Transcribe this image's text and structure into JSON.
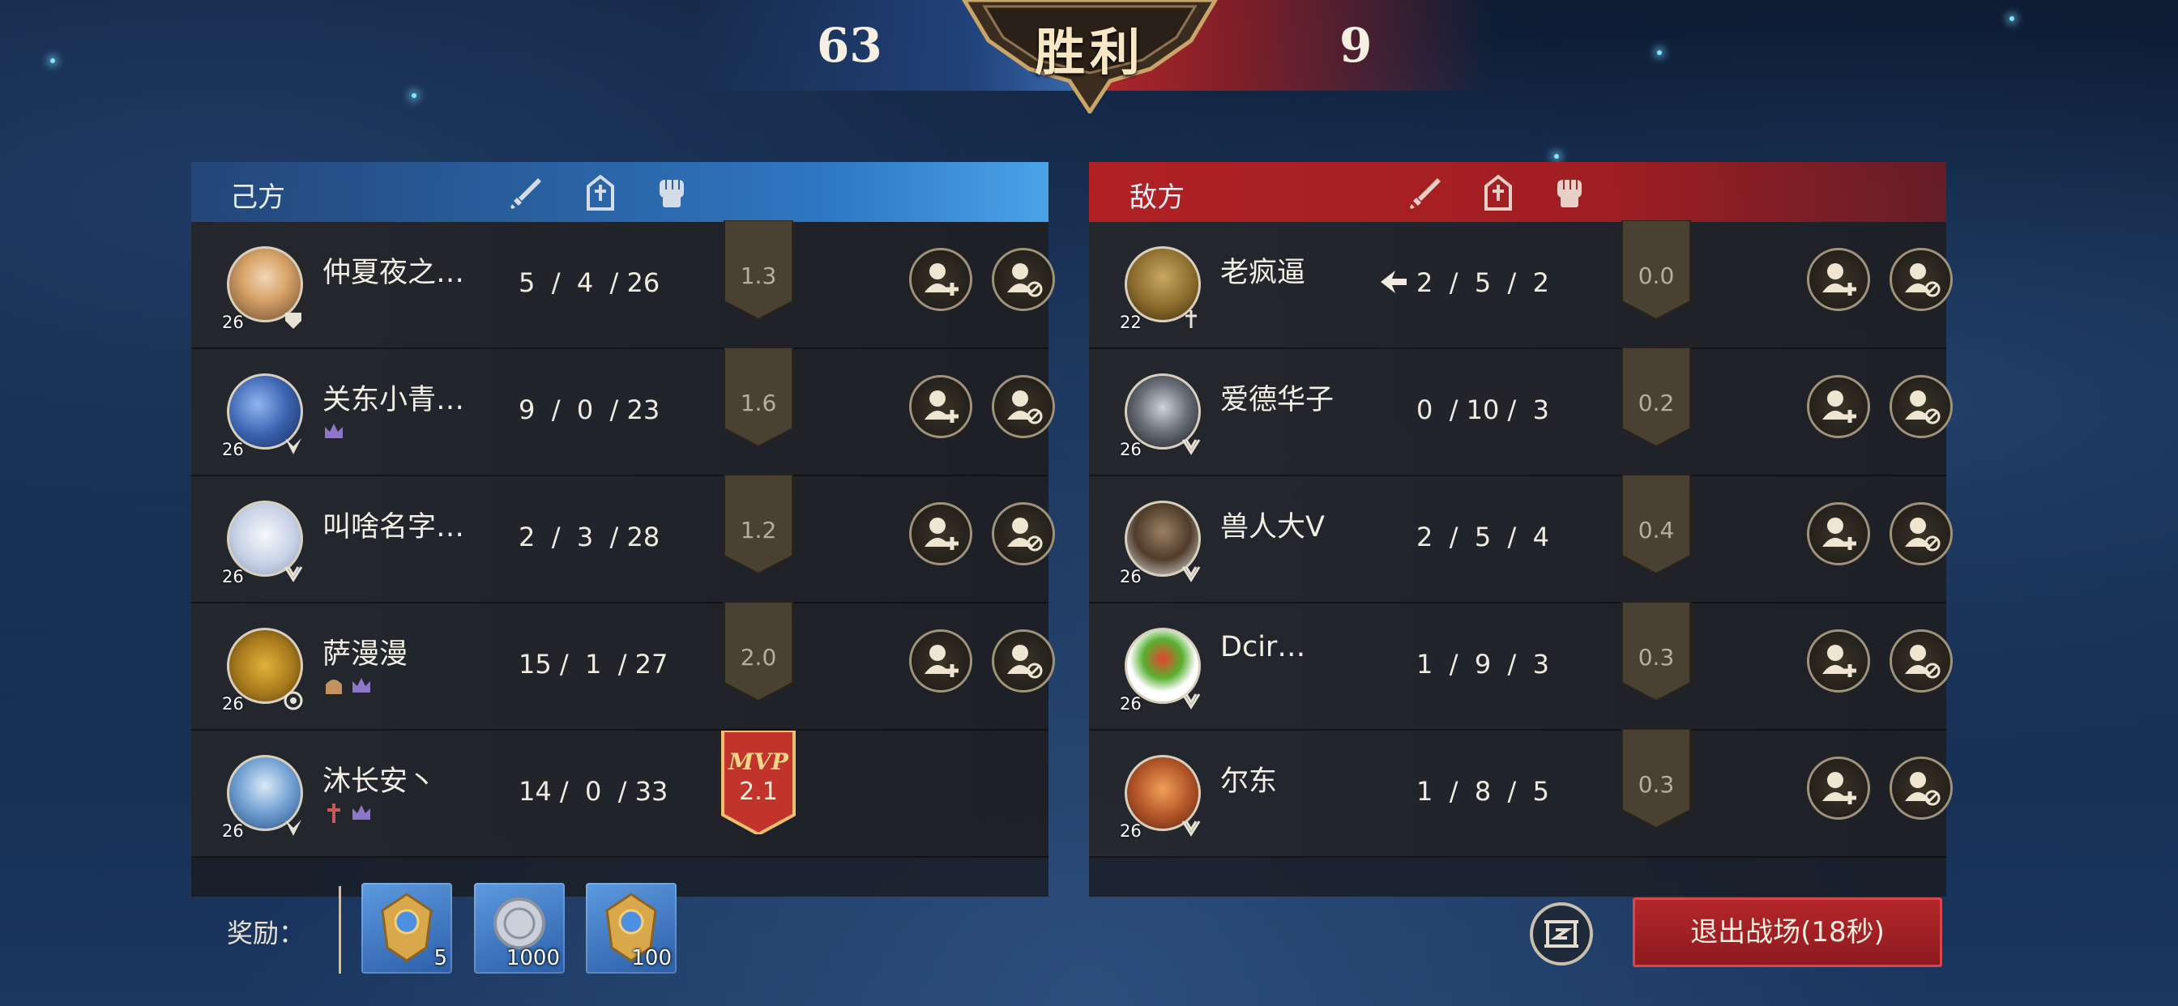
{
  "banner": {
    "score_ours": "63",
    "score_enemy": "9",
    "result": "胜利"
  },
  "team_ours": {
    "name": "己方",
    "column_icons": [
      "sword-icon",
      "tower-icon",
      "fist-icon"
    ],
    "players": [
      {
        "name": "仲夏夜之…",
        "level": "26",
        "kda": "5  /  4  / 26",
        "rating": "1.3",
        "mvp": false,
        "tags": [
          "trophy-icon"
        ]
      },
      {
        "name": "关东小青…",
        "level": "26",
        "kda": "9  /  0  / 23",
        "rating": "1.6",
        "mvp": false,
        "tags": [
          "crown-icon"
        ]
      },
      {
        "name": "叫啥名字…",
        "level": "26",
        "kda": "2  /  3  / 28",
        "rating": "1.2",
        "mvp": false,
        "tags": []
      },
      {
        "name": "萨漫漫",
        "level": "26",
        "kda": "15 /  1  / 27",
        "rating": "2.0",
        "mvp": false,
        "tags": [
          "helmet-icon",
          "crown-icon"
        ]
      },
      {
        "name": "沐长安丶",
        "level": "26",
        "kda": "14 /  0  / 33",
        "rating": "2.1",
        "mvp": true,
        "mvp_label": "MVP",
        "tags": [
          "cross-icon",
          "crown-icon"
        ]
      }
    ]
  },
  "team_enemy": {
    "name": "敌方",
    "column_icons": [
      "sword-icon",
      "tower-icon",
      "fist-icon"
    ],
    "players": [
      {
        "name": "老疯逼",
        "level": "22",
        "kda": "2  /  5  /  2",
        "rating": "0.0",
        "tags": [
          "flee-icon"
        ]
      },
      {
        "name": "爱德华子",
        "level": "26",
        "kda": "0  / 10 /  3",
        "rating": "0.2",
        "tags": []
      },
      {
        "name": "兽人大V",
        "level": "26",
        "kda": "2  /  5  /  4",
        "rating": "0.4",
        "tags": []
      },
      {
        "name": "Dcir…",
        "level": "26",
        "kda": "1  /  9  /  3",
        "rating": "0.3",
        "tags": []
      },
      {
        "name": "尔东",
        "level": "26",
        "kda": "1  /  8  /  5",
        "rating": "0.3",
        "tags": []
      }
    ]
  },
  "footer": {
    "reward_label": "奖励：",
    "rewards": [
      {
        "icon": "gold-badge-icon",
        "count": "5"
      },
      {
        "icon": "silver-coin-icon",
        "count": "1000"
      },
      {
        "icon": "gold-badge-icon",
        "count": "100"
      }
    ],
    "exit_label": "退出战场(18秒)"
  },
  "colors": {
    "ours": "#2f78c4",
    "enemy": "#b02125",
    "mvp": "#c0342c"
  }
}
